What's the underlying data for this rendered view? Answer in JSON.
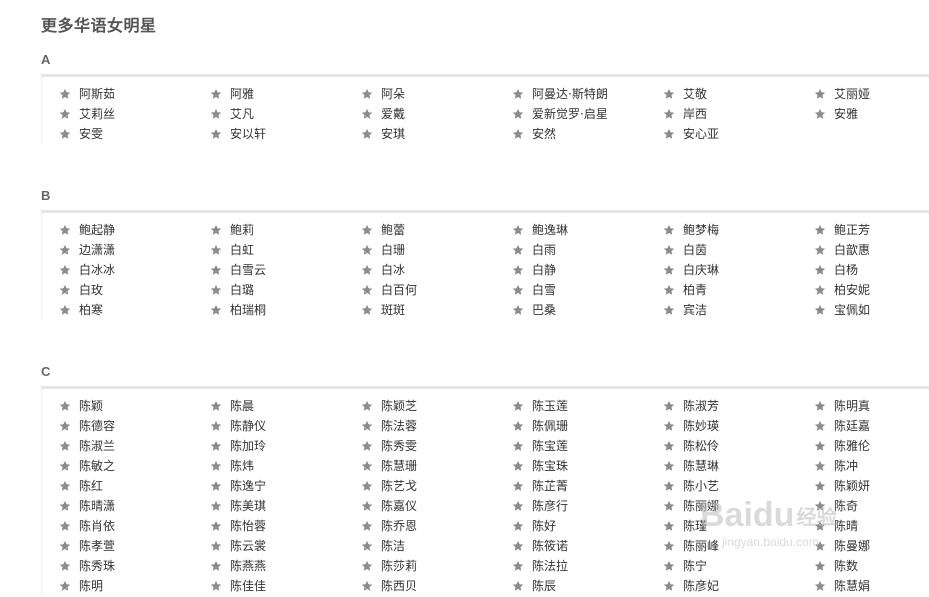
{
  "page": {
    "title": "更多华语女明星"
  },
  "icons": {
    "item_icon": "star-icon",
    "item_icon_color": "#8c8c8c"
  },
  "sections": [
    {
      "letter": "A",
      "names": [
        "阿斯茹",
        "阿雅",
        "阿朵",
        "阿曼达·斯特朗",
        "艾敬",
        "艾丽娅",
        "艾莉丝",
        "艾凡",
        "爱戴",
        "爱新觉罗·启星",
        "岸西",
        "安雅",
        "安雯",
        "安以轩",
        "安琪",
        "安然",
        "安心亚"
      ]
    },
    {
      "letter": "B",
      "names": [
        "鲍起静",
        "鲍莉",
        "鲍蕾",
        "鲍逸琳",
        "鲍梦梅",
        "鲍正芳",
        "边潇潇",
        "白虹",
        "白珊",
        "白雨",
        "白茵",
        "白歆惠",
        "白冰冰",
        "白雪云",
        "白冰",
        "白静",
        "白庆琳",
        "白杨",
        "白玫",
        "白璐",
        "白百何",
        "白雪",
        "柏青",
        "柏安妮",
        "柏寒",
        "柏瑞桐",
        "斑斑",
        "巴桑",
        "宾洁",
        "宝佩如"
      ]
    },
    {
      "letter": "C",
      "names": [
        "陈颖",
        "陈晨",
        "陈颖芝",
        "陈玉莲",
        "陈淑芳",
        "陈明真",
        "陈德容",
        "陈静仪",
        "陈法蓉",
        "陈佩珊",
        "陈妙瑛",
        "陈廷嘉",
        "陈淑兰",
        "陈加玲",
        "陈秀雯",
        "陈宝莲",
        "陈松伶",
        "陈雅伦",
        "陈敏之",
        "陈炜",
        "陈慧珊",
        "陈宝珠",
        "陈慧琳",
        "陈冲",
        "陈红",
        "陈逸宁",
        "陈艺戈",
        "陈芷菁",
        "陈小艺",
        "陈颖妍",
        "陈晴潇",
        "陈美琪",
        "陈嘉仪",
        "陈彦行",
        "陈丽娜",
        "陈奇",
        "陈肖依",
        "陈怡蓉",
        "陈乔恩",
        "陈好",
        "陈瑾",
        "陈晴",
        "陈孝萱",
        "陈云裳",
        "陈洁",
        "陈筱诺",
        "陈丽峰",
        "陈曼娜",
        "陈秀珠",
        "陈燕燕",
        "陈莎莉",
        "陈法拉",
        "陈宁",
        "陈数",
        "陈明",
        "陈佳佳",
        "陈西贝",
        "陈辰",
        "陈彦妃",
        "陈慧娟"
      ]
    }
  ],
  "watermark": {
    "logo_text": "Baidu",
    "logo_suffix": "经验",
    "url": "jingyan.baidu.com"
  }
}
